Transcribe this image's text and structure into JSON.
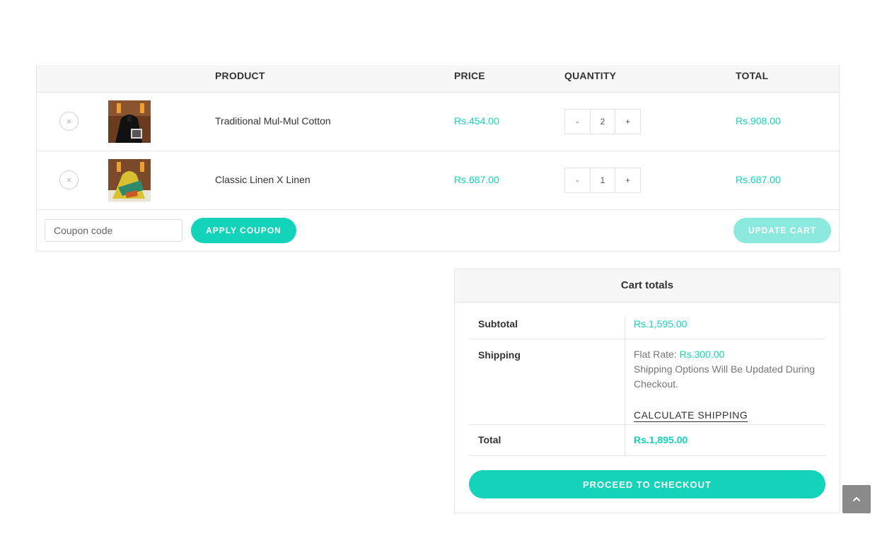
{
  "cart_table": {
    "headers": {
      "product": "PRODUCT",
      "price": "PRICE",
      "quantity": "QUANTITY",
      "total": "TOTAL"
    },
    "rows": [
      {
        "remove": "×",
        "name": "Traditional Mul-Mul Cotton",
        "price": "Rs.454.00",
        "qty_minus": "-",
        "qty": "2",
        "qty_plus": "+",
        "total": "Rs.908.00"
      },
      {
        "remove": "×",
        "name": "Classic Linen X Linen",
        "price": "Rs.687.00",
        "qty_minus": "-",
        "qty": "1",
        "qty_plus": "+",
        "total": "Rs.687.00"
      }
    ],
    "coupon_placeholder": "Coupon code",
    "apply_coupon": "APPLY COUPON",
    "update_cart": "UPDATE CART"
  },
  "cart_totals": {
    "title": "Cart totals",
    "subtotal_label": "Subtotal",
    "subtotal_value": "Rs.1,595.00",
    "shipping_label": "Shipping",
    "shipping_flat": "Flat Rate: ",
    "shipping_amount": "Rs.300.00",
    "shipping_note": "Shipping Options Will Be Updated During Checkout.",
    "calculate_shipping": "CALCULATE SHIPPING",
    "total_label": "Total",
    "total_value": "Rs.1,895.00",
    "checkout": "PROCEED TO CHECKOUT"
  },
  "colors": {
    "accent": "#13d3bb",
    "accent_disabled": "#8ce9dd",
    "scroll_button": "#8a8a8a"
  },
  "icons": {
    "remove": "close-circle-icon",
    "scroll_top": "chevron-up-icon"
  }
}
